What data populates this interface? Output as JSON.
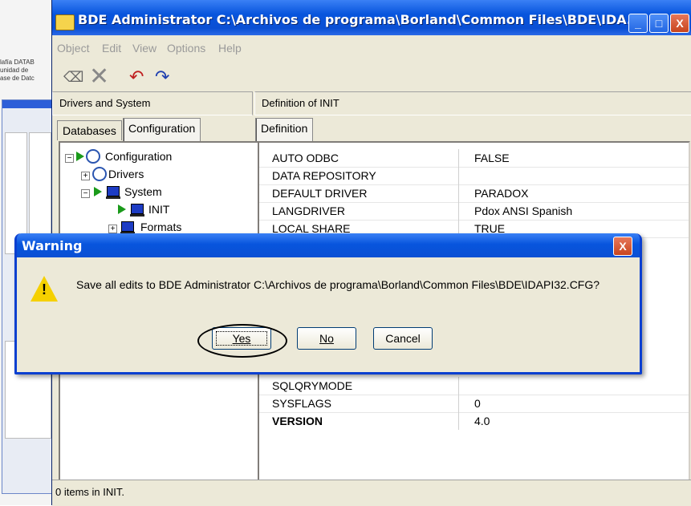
{
  "background_window": {
    "fragments": [
      "lafía DATAB",
      "unidad de",
      "ase de Datc"
    ]
  },
  "window": {
    "title": "BDE Administrator  C:\\Archivos de programa\\Borland\\Common Files\\BDE\\IDA...",
    "minimize": "_",
    "maximize": "□",
    "close": "X"
  },
  "menu": {
    "items": [
      "Object",
      "Edit",
      "View",
      "Options",
      "Help"
    ]
  },
  "toolbar": {
    "icons": [
      "open-icon",
      "delete-icon",
      "undo-icon",
      "redo-icon"
    ]
  },
  "left_pane": {
    "header": "Drivers and System",
    "tabs": [
      "Databases",
      "Configuration"
    ],
    "tree": {
      "configuration": "Configuration",
      "drivers": "Drivers",
      "system": "System",
      "init": "INIT",
      "formats": "Formats"
    }
  },
  "right_pane": {
    "header": "Definition of INIT",
    "tab": "Definition",
    "rows": [
      {
        "name": "AUTO ODBC",
        "value": "FALSE"
      },
      {
        "name": "DATA REPOSITORY",
        "value": ""
      },
      {
        "name": "DEFAULT DRIVER",
        "value": "PARADOX"
      },
      {
        "name": "LANGDRIVER",
        "value": "Pdox ANSI Spanish"
      },
      {
        "name": "LOCAL SHARE",
        "value": "TRUE"
      }
    ],
    "bottom_rows": [
      {
        "name": "SQLQRYMODE",
        "value": ""
      },
      {
        "name": "SYSFLAGS",
        "value": "0"
      },
      {
        "name": "VERSION",
        "value": "4.0"
      }
    ]
  },
  "status": {
    "text": "0 items in INIT."
  },
  "dialog": {
    "title": "Warning",
    "close": "X",
    "message": "Save all edits to BDE Administrator  C:\\Archivos de programa\\Borland\\Common Files\\BDE\\IDAPI32.CFG?",
    "yes": "Yes",
    "no": "No",
    "cancel": "Cancel"
  }
}
